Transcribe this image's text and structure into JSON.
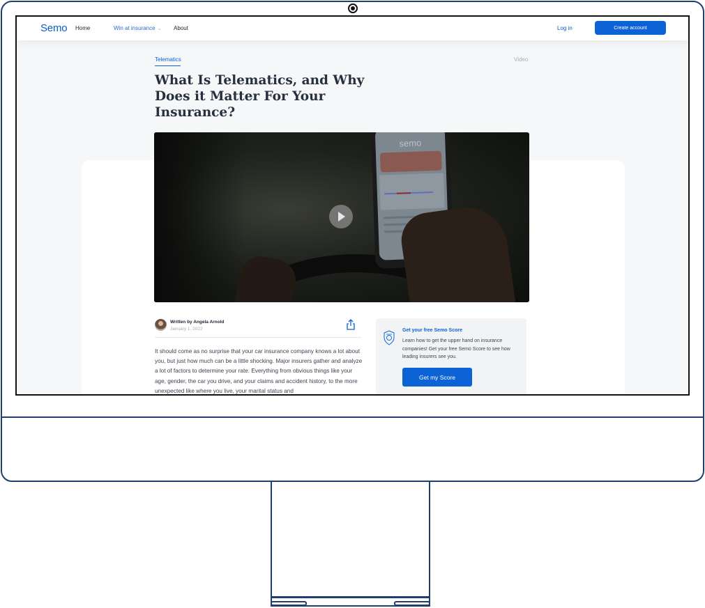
{
  "nav": {
    "logo": "Semo",
    "home": "Home",
    "win": "Win at insurance",
    "about": "About",
    "login": "Log in",
    "create": "Create account"
  },
  "article": {
    "category": "Telematics",
    "type_tag": "Video",
    "title": "What Is Telematics, and Why Does it Matter For Your Insurance?",
    "author_line": "Written by Angela Arnold",
    "date": "January 1, 2022",
    "body": "It should come as no surprise that your car insurance company knows a lot about you, but just how much can be a little shocking. Major insurers gather and analyze a lot of factors to determine your rate. Everything from obvious things like your age, gender, the car you drive,  and your claims and accident history, to the more unexpected like where you live, your marital status and"
  },
  "video": {
    "phone_brand": "semo"
  },
  "score_card": {
    "title": "Get your free Semo Score",
    "description": "Learn how to get the upper hand on insurance companies! Get your free Semo Score to see how leading insurers see you.",
    "button": "Get my Score"
  },
  "colors": {
    "brand_blue": "#0b63d6",
    "frame": "#1f3f6e"
  }
}
